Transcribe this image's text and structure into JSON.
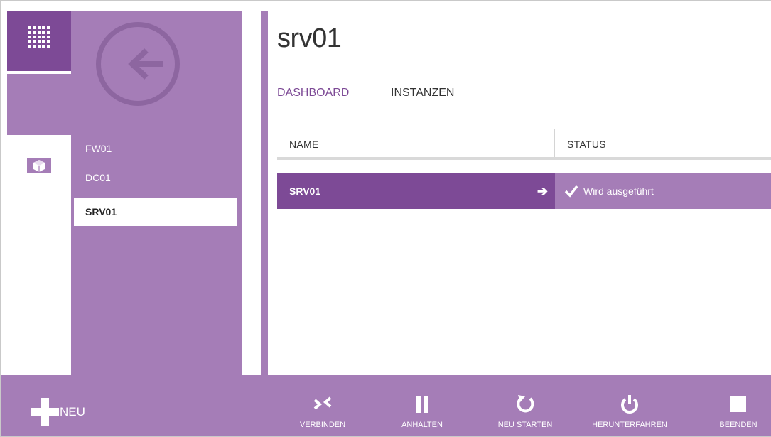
{
  "colors": {
    "accent_dark": "#7d4a96",
    "accent_light": "#a57db7",
    "accent_mid": "#8d66a0",
    "text_dark": "#333333",
    "rule": "#d9d9d9"
  },
  "rail": {
    "items": [
      {
        "icon": "all-items-grid-icon"
      },
      {
        "icon": "virtual-machine-icon"
      }
    ]
  },
  "list": {
    "back_icon": "back-arrow-icon",
    "items": [
      {
        "label": "FW01"
      },
      {
        "label": "DC01"
      },
      {
        "label": "SRV01"
      }
    ]
  },
  "main": {
    "title": "srv01",
    "tabs": [
      {
        "label": "DASHBOARD"
      },
      {
        "label": "INSTANZEN"
      }
    ],
    "table": {
      "columns": [
        "NAME",
        "STATUS"
      ],
      "rows": [
        {
          "name": "SRV01",
          "status": "Wird ausgeführt",
          "arrow": "➔"
        }
      ]
    }
  },
  "commandbar": {
    "new_label": "NEU",
    "commands": [
      {
        "label": "VERBINDEN",
        "icon": "connect-icon"
      },
      {
        "label": "ANHALTEN",
        "icon": "pause-icon"
      },
      {
        "label": "NEU STARTEN",
        "icon": "restart-icon"
      },
      {
        "label": "HERUNTERFAHREN",
        "icon": "power-icon"
      },
      {
        "label": "BEENDEN",
        "icon": "stop-icon"
      }
    ]
  }
}
